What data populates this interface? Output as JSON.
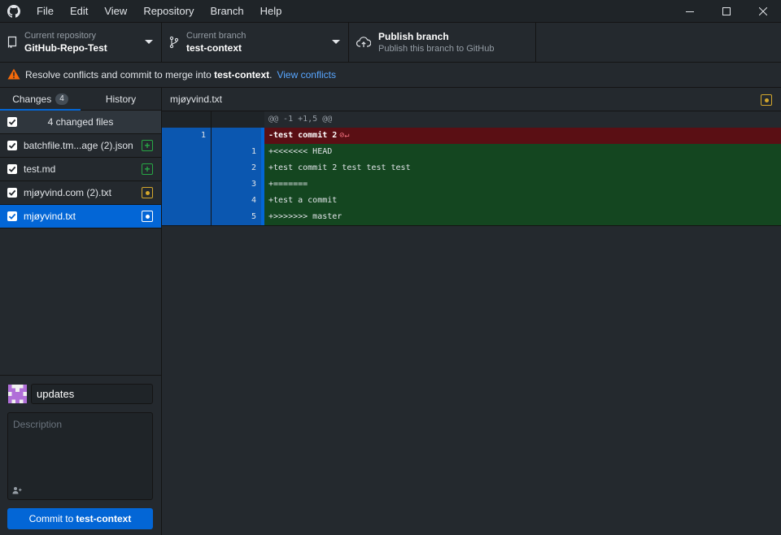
{
  "menu": {
    "items": [
      "File",
      "Edit",
      "View",
      "Repository",
      "Branch",
      "Help"
    ]
  },
  "toolbar": {
    "repo": {
      "label": "Current repository",
      "value": "GitHub-Repo-Test"
    },
    "branch": {
      "label": "Current branch",
      "value": "test-context"
    },
    "publish": {
      "title": "Publish branch",
      "subtitle": "Publish this branch to GitHub"
    }
  },
  "banner": {
    "text_before": "Resolve conflicts and commit to merge into ",
    "branch": "test-context",
    "text_after": ".",
    "link": "View conflicts"
  },
  "sidebar": {
    "tabs": [
      {
        "label": "Changes",
        "count": "4"
      },
      {
        "label": "History"
      }
    ],
    "files_header": "4 changed files",
    "files": [
      {
        "name": "batchfile.tm...age (2).json",
        "status": "added"
      },
      {
        "name": "test.md",
        "status": "added"
      },
      {
        "name": "mjøyvind.com (2).txt",
        "status": "modified"
      },
      {
        "name": "mjøyvind.txt",
        "status": "conflicted"
      }
    ]
  },
  "commit": {
    "summary": "updates",
    "description_placeholder": "Description",
    "button_prefix": "Commit to",
    "button_branch": "test-context"
  },
  "diff": {
    "filename": "mjøyvind.txt",
    "hunk": "@@ -1 +1,5 @@",
    "lines": [
      {
        "type": "del",
        "old": "1",
        "new": "",
        "text": "-test commit 2"
      },
      {
        "type": "add",
        "old": "",
        "new": "1",
        "text": "+<<<<<<< HEAD"
      },
      {
        "type": "add",
        "old": "",
        "new": "2",
        "text": "+test commit 2 test test test"
      },
      {
        "type": "add",
        "old": "",
        "new": "3",
        "text": "+======="
      },
      {
        "type": "add",
        "old": "",
        "new": "4",
        "text": "+test a commit"
      },
      {
        "type": "add",
        "old": "",
        "new": "5",
        "text": "+>>>>>>> master"
      }
    ]
  },
  "colors": {
    "accent": "#0366d6",
    "added": "#28a745",
    "modified": "#d4a72c",
    "warning": "#f66a0a"
  }
}
